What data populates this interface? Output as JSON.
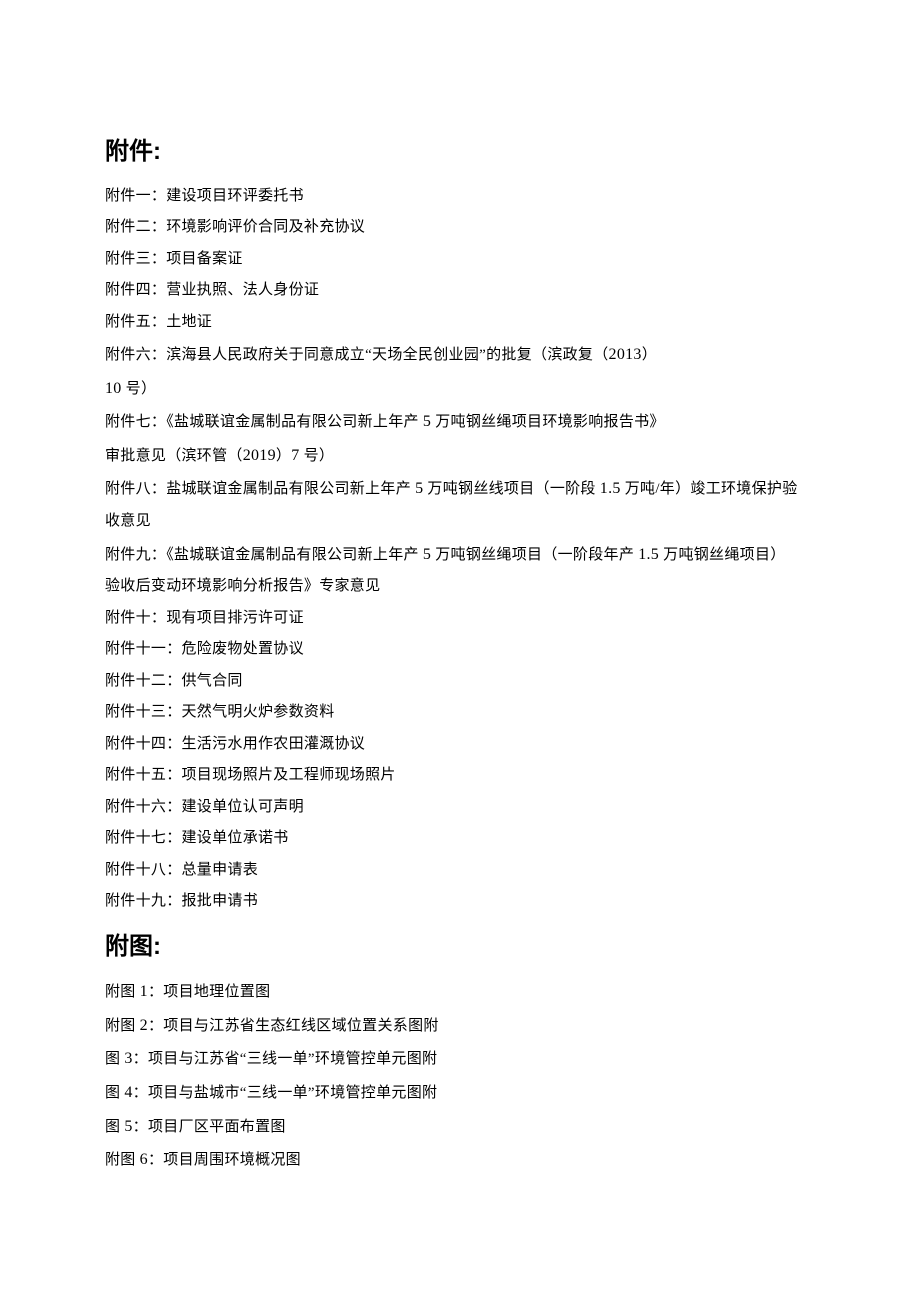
{
  "sections": {
    "attachments": {
      "heading": "附件:",
      "items": [
        "附件一：建设项目环评委托书",
        "附件二：环境影响评价合同及补充协议",
        "附件三：项目备案证",
        "附件四：营业执照、法人身份证",
        "附件五：土地证",
        "附件六：滨海县人民政府关于同意成立“天场全民创业园”的批复（滨政复（2013）",
        "10 号）",
        "附件七：《盐城联谊金属制品有限公司新上年产 5 万吨钢丝绳项目环境影响报告书》",
        "审批意见（滨环管（2019）7 号）",
        "附件八：盐城联谊金属制品有限公司新上年产 5 万吨钢丝线项目（一阶段 1.5 万吨/年）竣工环境保护验",
        "收意见",
        "附件九：《盐城联谊金属制品有限公司新上年产 5 万吨钢丝绳项目（一阶段年产 1.5 万吨钢丝绳项目）",
        "验收后变动环境影响分析报告》专家意见",
        "附件十：现有项目排污许可证",
        "附件十一：危险废物处置协议",
        "附件十二：供气合同",
        "附件十三：天然气明火炉参数资料",
        "附件十四：生活污水用作农田灌溉协议",
        "附件十五：项目现场照片及工程师现场照片",
        "附件十六：建设单位认可声明",
        "附件十七：建设单位承诺书",
        "附件十八：总量申请表",
        "附件十九：报批申请书"
      ]
    },
    "figures": {
      "heading": "附图:",
      "items": [
        "附图 1：项目地理位置图",
        "附图 2：项目与江苏省生态红线区域位置关系图附",
        "图 3：项目与江苏省“三线一单”环境管控单元图附",
        "图 4：项目与盐城市“三线一单”环境管控单元图附",
        "图 5：项目厂区平面布置图",
        "附图 6：项目周围环境概况图"
      ]
    }
  }
}
